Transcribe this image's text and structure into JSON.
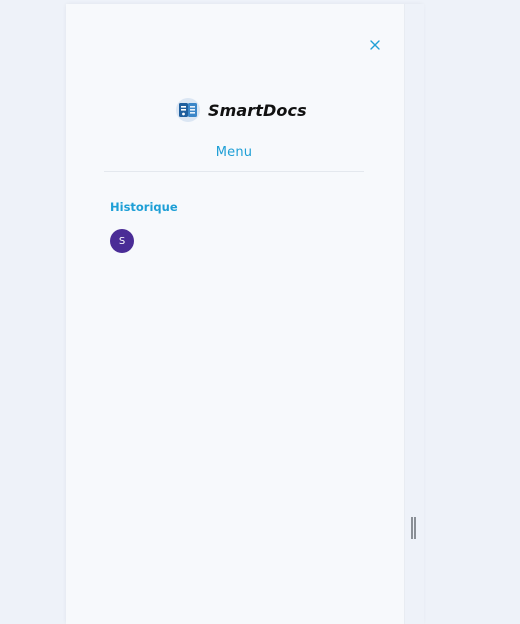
{
  "brand": {
    "name": "SmartDocs",
    "logo_icon": "smartdocs-logo"
  },
  "menu": {
    "title": "Menu",
    "close_icon": "close-icon"
  },
  "history": {
    "label": "Historique",
    "avatar_initial": "S"
  },
  "colors": {
    "accent": "#1e9fd6",
    "avatar_bg": "#4a2c96",
    "panel_bg": "#f7f9fc",
    "page_bg": "#eef2f9"
  }
}
